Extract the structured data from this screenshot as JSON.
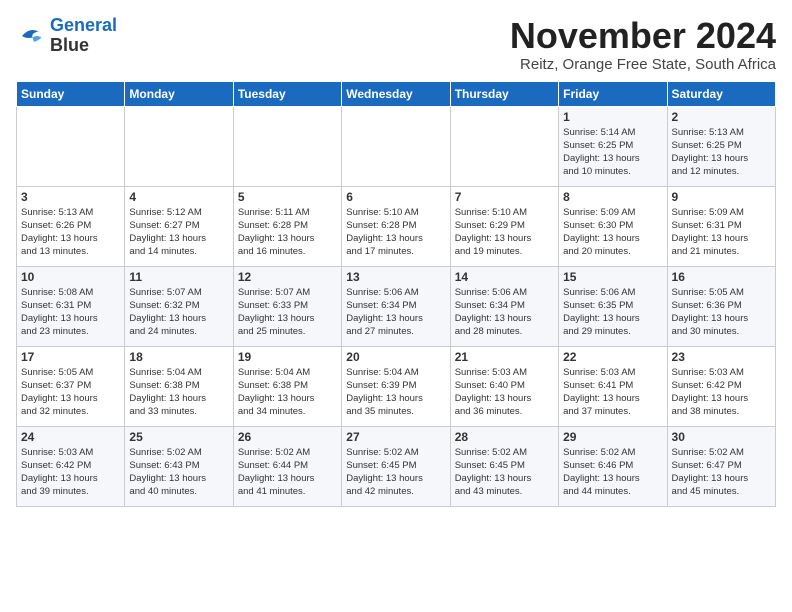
{
  "header": {
    "logo_line1": "General",
    "logo_line2": "Blue",
    "month": "November 2024",
    "location": "Reitz, Orange Free State, South Africa"
  },
  "weekdays": [
    "Sunday",
    "Monday",
    "Tuesday",
    "Wednesday",
    "Thursday",
    "Friday",
    "Saturday"
  ],
  "weeks": [
    [
      {
        "day": "",
        "info": ""
      },
      {
        "day": "",
        "info": ""
      },
      {
        "day": "",
        "info": ""
      },
      {
        "day": "",
        "info": ""
      },
      {
        "day": "",
        "info": ""
      },
      {
        "day": "1",
        "info": "Sunrise: 5:14 AM\nSunset: 6:25 PM\nDaylight: 13 hours\nand 10 minutes."
      },
      {
        "day": "2",
        "info": "Sunrise: 5:13 AM\nSunset: 6:25 PM\nDaylight: 13 hours\nand 12 minutes."
      }
    ],
    [
      {
        "day": "3",
        "info": "Sunrise: 5:13 AM\nSunset: 6:26 PM\nDaylight: 13 hours\nand 13 minutes."
      },
      {
        "day": "4",
        "info": "Sunrise: 5:12 AM\nSunset: 6:27 PM\nDaylight: 13 hours\nand 14 minutes."
      },
      {
        "day": "5",
        "info": "Sunrise: 5:11 AM\nSunset: 6:28 PM\nDaylight: 13 hours\nand 16 minutes."
      },
      {
        "day": "6",
        "info": "Sunrise: 5:10 AM\nSunset: 6:28 PM\nDaylight: 13 hours\nand 17 minutes."
      },
      {
        "day": "7",
        "info": "Sunrise: 5:10 AM\nSunset: 6:29 PM\nDaylight: 13 hours\nand 19 minutes."
      },
      {
        "day": "8",
        "info": "Sunrise: 5:09 AM\nSunset: 6:30 PM\nDaylight: 13 hours\nand 20 minutes."
      },
      {
        "day": "9",
        "info": "Sunrise: 5:09 AM\nSunset: 6:31 PM\nDaylight: 13 hours\nand 21 minutes."
      }
    ],
    [
      {
        "day": "10",
        "info": "Sunrise: 5:08 AM\nSunset: 6:31 PM\nDaylight: 13 hours\nand 23 minutes."
      },
      {
        "day": "11",
        "info": "Sunrise: 5:07 AM\nSunset: 6:32 PM\nDaylight: 13 hours\nand 24 minutes."
      },
      {
        "day": "12",
        "info": "Sunrise: 5:07 AM\nSunset: 6:33 PM\nDaylight: 13 hours\nand 25 minutes."
      },
      {
        "day": "13",
        "info": "Sunrise: 5:06 AM\nSunset: 6:34 PM\nDaylight: 13 hours\nand 27 minutes."
      },
      {
        "day": "14",
        "info": "Sunrise: 5:06 AM\nSunset: 6:34 PM\nDaylight: 13 hours\nand 28 minutes."
      },
      {
        "day": "15",
        "info": "Sunrise: 5:06 AM\nSunset: 6:35 PM\nDaylight: 13 hours\nand 29 minutes."
      },
      {
        "day": "16",
        "info": "Sunrise: 5:05 AM\nSunset: 6:36 PM\nDaylight: 13 hours\nand 30 minutes."
      }
    ],
    [
      {
        "day": "17",
        "info": "Sunrise: 5:05 AM\nSunset: 6:37 PM\nDaylight: 13 hours\nand 32 minutes."
      },
      {
        "day": "18",
        "info": "Sunrise: 5:04 AM\nSunset: 6:38 PM\nDaylight: 13 hours\nand 33 minutes."
      },
      {
        "day": "19",
        "info": "Sunrise: 5:04 AM\nSunset: 6:38 PM\nDaylight: 13 hours\nand 34 minutes."
      },
      {
        "day": "20",
        "info": "Sunrise: 5:04 AM\nSunset: 6:39 PM\nDaylight: 13 hours\nand 35 minutes."
      },
      {
        "day": "21",
        "info": "Sunrise: 5:03 AM\nSunset: 6:40 PM\nDaylight: 13 hours\nand 36 minutes."
      },
      {
        "day": "22",
        "info": "Sunrise: 5:03 AM\nSunset: 6:41 PM\nDaylight: 13 hours\nand 37 minutes."
      },
      {
        "day": "23",
        "info": "Sunrise: 5:03 AM\nSunset: 6:42 PM\nDaylight: 13 hours\nand 38 minutes."
      }
    ],
    [
      {
        "day": "24",
        "info": "Sunrise: 5:03 AM\nSunset: 6:42 PM\nDaylight: 13 hours\nand 39 minutes."
      },
      {
        "day": "25",
        "info": "Sunrise: 5:02 AM\nSunset: 6:43 PM\nDaylight: 13 hours\nand 40 minutes."
      },
      {
        "day": "26",
        "info": "Sunrise: 5:02 AM\nSunset: 6:44 PM\nDaylight: 13 hours\nand 41 minutes."
      },
      {
        "day": "27",
        "info": "Sunrise: 5:02 AM\nSunset: 6:45 PM\nDaylight: 13 hours\nand 42 minutes."
      },
      {
        "day": "28",
        "info": "Sunrise: 5:02 AM\nSunset: 6:45 PM\nDaylight: 13 hours\nand 43 minutes."
      },
      {
        "day": "29",
        "info": "Sunrise: 5:02 AM\nSunset: 6:46 PM\nDaylight: 13 hours\nand 44 minutes."
      },
      {
        "day": "30",
        "info": "Sunrise: 5:02 AM\nSunset: 6:47 PM\nDaylight: 13 hours\nand 45 minutes."
      }
    ]
  ]
}
